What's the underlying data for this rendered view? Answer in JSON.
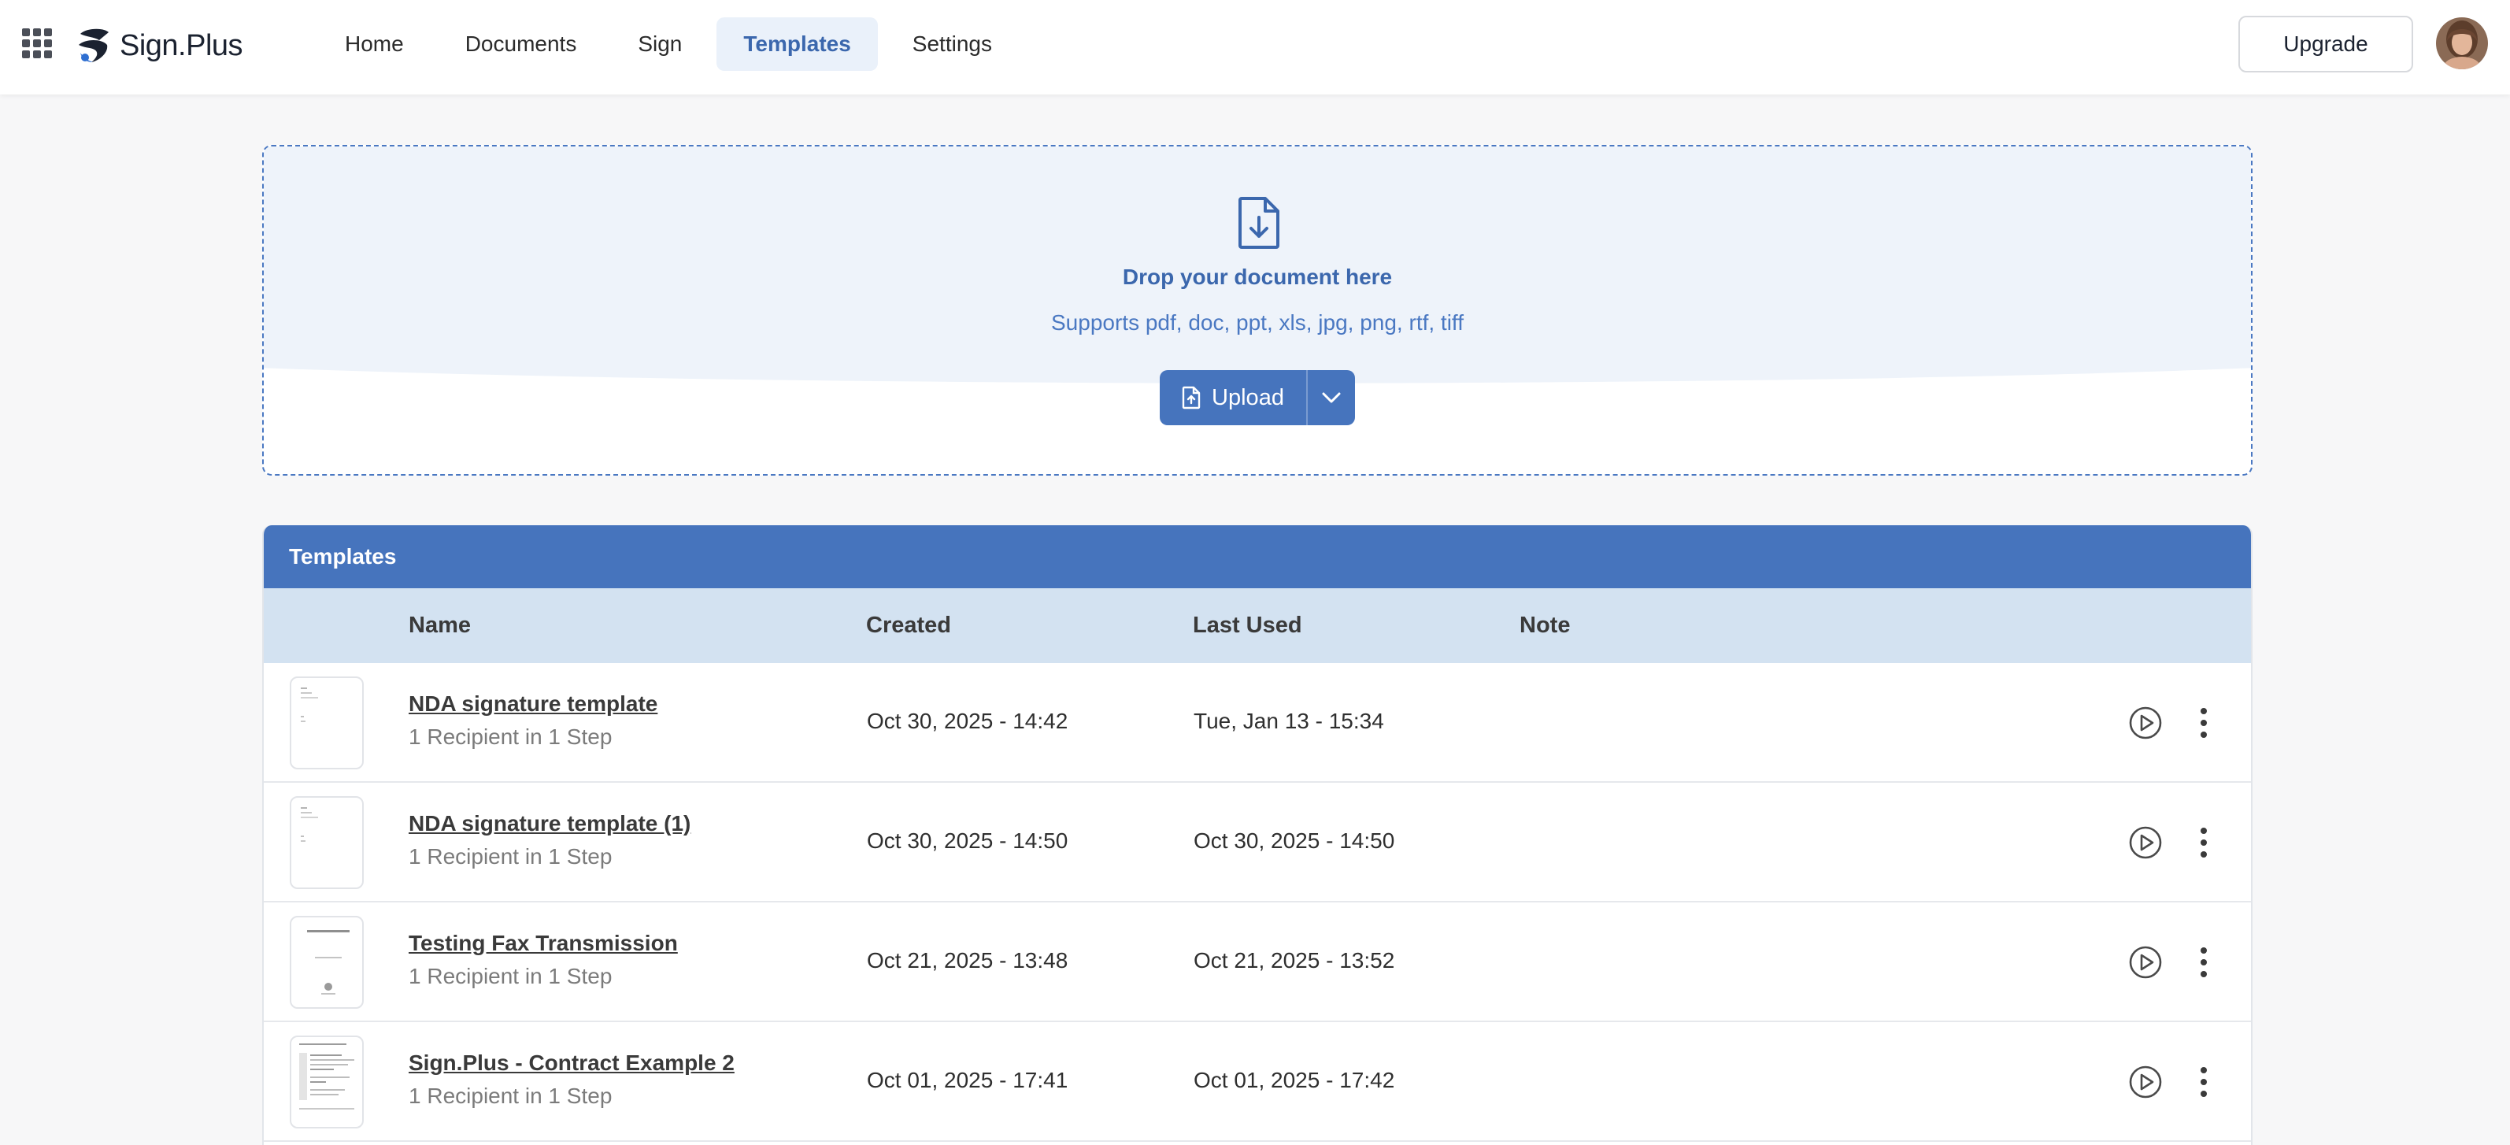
{
  "brand": {
    "name": "Sign.Plus"
  },
  "nav": {
    "items": [
      {
        "label": "Home",
        "active": false
      },
      {
        "label": "Documents",
        "active": false
      },
      {
        "label": "Sign",
        "active": false
      },
      {
        "label": "Templates",
        "active": true
      },
      {
        "label": "Settings",
        "active": false
      }
    ],
    "upgrade_label": "Upgrade"
  },
  "dropzone": {
    "title": "Drop your document here",
    "subtitle": "Supports pdf, doc, ppt, xls, jpg, png, rtf, tiff",
    "upload_label": "Upload"
  },
  "templates": {
    "title": "Templates",
    "columns": {
      "name": "Name",
      "created": "Created",
      "last_used": "Last Used",
      "note": "Note"
    },
    "rows": [
      {
        "name": "NDA signature template",
        "recipients": "1 Recipient in 1 Step",
        "created": "Oct 30, 2025 - 14:42",
        "last_used": "Tue, Jan 13 - 15:34",
        "note": ""
      },
      {
        "name": "NDA signature template (1)",
        "recipients": "1 Recipient in 1 Step",
        "created": "Oct 30, 2025 - 14:50",
        "last_used": "Oct 30, 2025 - 14:50",
        "note": ""
      },
      {
        "name": "Testing Fax Transmission",
        "recipients": "1 Recipient in 1 Step",
        "created": "Oct 21, 2025 - 13:48",
        "last_used": "Oct 21, 2025 - 13:52",
        "note": ""
      },
      {
        "name": "Sign.Plus - Contract Example 2",
        "recipients": "1 Recipient in 1 Step",
        "created": "Oct 01, 2025 - 17:41",
        "last_used": "Oct 01, 2025 - 17:42",
        "note": ""
      }
    ]
  },
  "colors": {
    "accent": "#4674bd",
    "accent_text": "#3b67ad",
    "header_row": "#d3e2f1",
    "dropzone_fill": "#eef3fa"
  },
  "icons": {
    "apps": "grid-icon",
    "dropzone": "document-download-icon",
    "upload": "file-upload-icon",
    "upload_menu": "chevron-down-icon",
    "row_play": "play-circle-icon",
    "row_more": "more-vertical-icon"
  }
}
